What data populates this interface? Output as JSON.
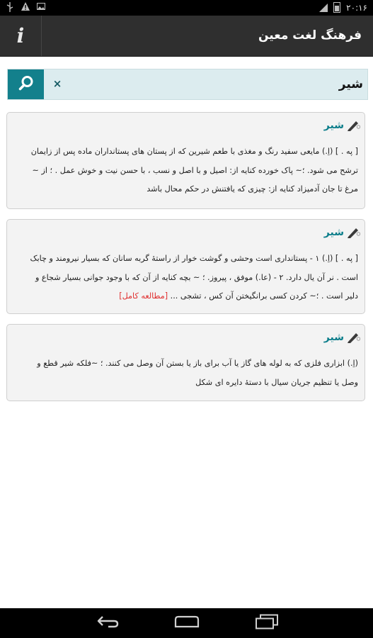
{
  "status_bar": {
    "time": "۲۰:۱۶",
    "left_icons": [
      "usb-icon",
      "warning-icon",
      "image-icon"
    ],
    "right_icons": [
      "battery-icon",
      "signal-icon"
    ]
  },
  "app_bar": {
    "title": "فرهنگ لغت معین",
    "info_label": "i"
  },
  "search": {
    "value": "شیر",
    "clear_label": "×"
  },
  "results": [
    {
      "word": "شیر",
      "lines": [
        "[ په . ] (اِ.) مایعی سفید رنگ و مغذی با طعم شیرین که از پستان های پستانداران ماده پس از زایمان",
        "ترشح می شود. ؛~ پاک خورده کنایه از: اصیل و با اصل و نسب ، با حسن نیت و خوش عمل . ؛ از ~",
        "مرغ تا جان آدمیزاد کنایه از: چیزی که یافتنش در حکم محال باشد"
      ]
    },
    {
      "word": "شیر",
      "lines": [
        "[ په . ] (اِ.) ۱ - پستانداری است وحشی و گوشت خوار از راستهٔ گربه سانان که بسیار نیرومند و چابک",
        "است . نر آن یال دارد. ۲ - (عا.) موفق ، پیروز. ؛ ~ بچه کنایه از آن که با وجود جوانی بسیار شجاع و",
        "دلیر است . ؛~ کردن کسی برانگیختن آن کس ، تشجی ..."
      ],
      "more_label": "[مطالعه کامل]"
    },
    {
      "word": "شیر",
      "lines": [
        "(اِ.) ابزاری فلزی که به لوله های گاز یا آب برای باز یا بستن آن وصل می کنند. ؛ ~فلکه شیر قطع و",
        "وصل یا تنظیم جریان سیال با دستهٔ دایره ای شکل"
      ]
    }
  ],
  "colors": {
    "accent": "#13808c",
    "word": "#0a7d8a",
    "link": "#e03030",
    "app_bar": "#2f2f2f",
    "search_bg": "#dcecef"
  }
}
